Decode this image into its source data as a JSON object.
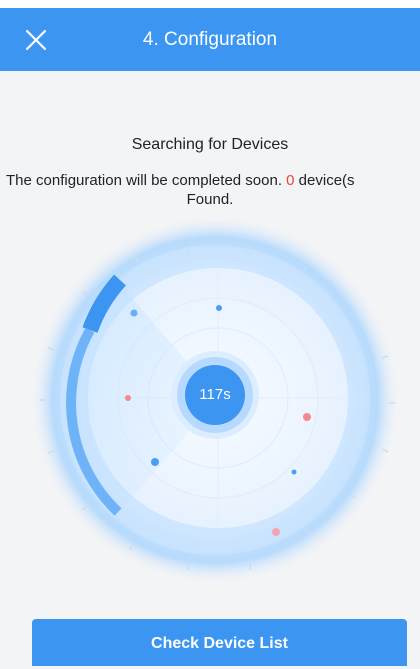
{
  "header": {
    "title": "4. Configuration",
    "close_icon": "close-icon"
  },
  "search": {
    "title": "Searching for Devices",
    "desc_before": "The configuration will be completed soon. ",
    "count": "0",
    "desc_after": " device(s",
    "desc_line2": "Found."
  },
  "radar": {
    "timer": "117s"
  },
  "footer": {
    "button_label": "Check Device List"
  },
  "colors": {
    "primary": "#3b95f1",
    "count": "#e8463d"
  }
}
